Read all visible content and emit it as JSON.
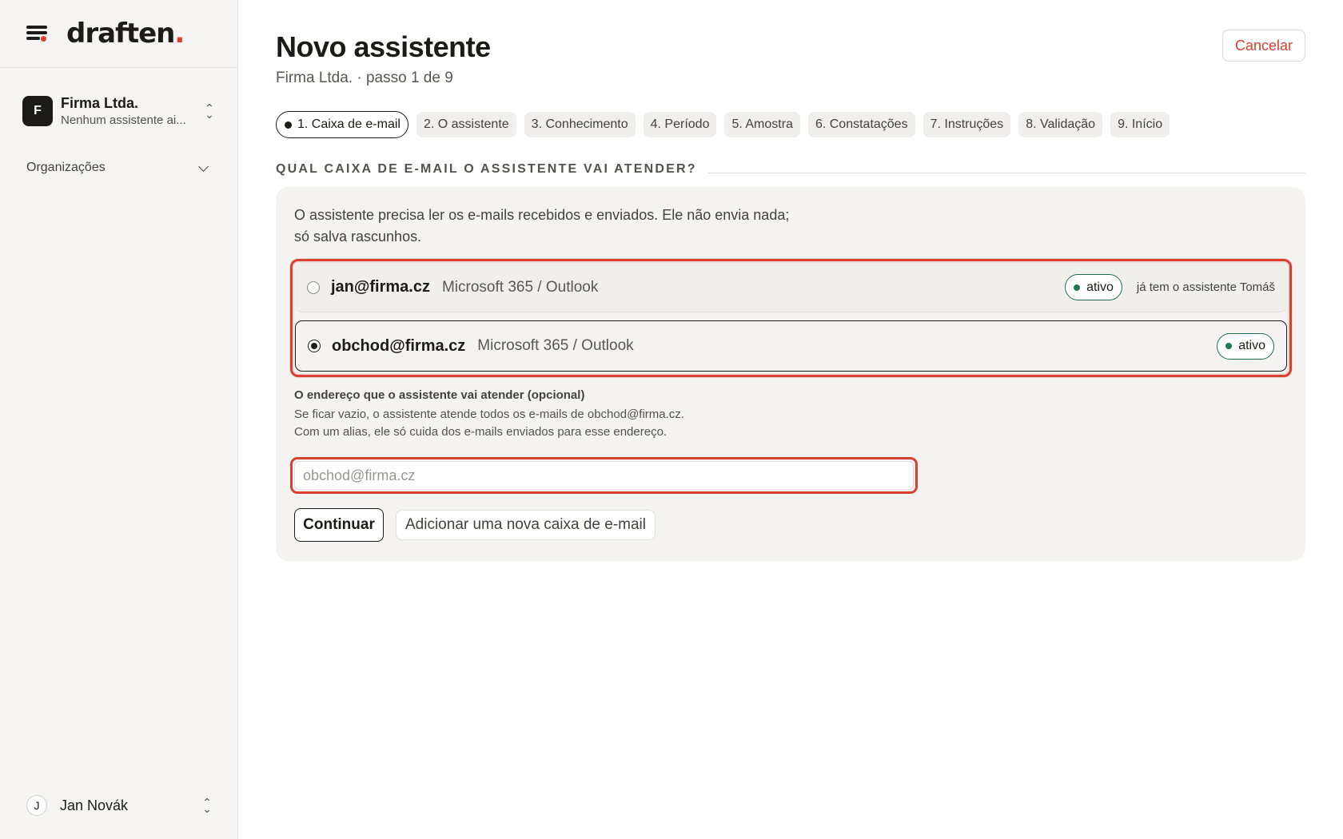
{
  "app": {
    "logo_text": "draften",
    "logo_dot": ".",
    "brand_color": "#d8412f"
  },
  "sidebar": {
    "org": {
      "initial": "F",
      "name": "Firma Ltda.",
      "subtitle": "Nenhum assistente ai..."
    },
    "organizations_label": "Organizações",
    "user": {
      "initial": "J",
      "name": "Jan Novák"
    }
  },
  "header": {
    "title": "Novo assistente",
    "subtitle": "Firma Ltda. · passo 1 de 9",
    "cancel_label": "Cancelar"
  },
  "steps": [
    {
      "label": "1. Caixa de e-mail",
      "active": true
    },
    {
      "label": "2. O assistente"
    },
    {
      "label": "3. Conhecimento"
    },
    {
      "label": "4. Período"
    },
    {
      "label": "5. Amostra"
    },
    {
      "label": "6. Constatações"
    },
    {
      "label": "7. Instruções"
    },
    {
      "label": "8. Validação"
    },
    {
      "label": "9. Início"
    }
  ],
  "section": {
    "heading": "QUAL CAIXA DE E-MAIL O ASSISTENTE VAI ATENDER?"
  },
  "mailbox": {
    "intro": "O assistente precisa ler os e-mails recebidos e enviados. Ele não envia nada; só salva rascunhos.",
    "options": [
      {
        "email": "jan@firma.cz",
        "provider": "Microsoft 365 / Outlook",
        "status": "ativo",
        "note": "já tem o assistente Tomáš",
        "selected": false
      },
      {
        "email": "obchod@firma.cz",
        "provider": "Microsoft 365 / Outlook",
        "status": "ativo",
        "selected": true
      }
    ],
    "alias_label": "O endereço que o assistente vai atender (opcional)",
    "alias_help": "Se ficar vazio, o assistente atende todos os e-mails de obchod@firma.cz. Com um alias, ele só cuida dos e-mails enviados para esse endereço.",
    "alias_value": "",
    "alias_placeholder": "obchod@firma.cz",
    "continue_label": "Continuar",
    "add_label": "Adicionar uma nova caixa de e-mail"
  }
}
